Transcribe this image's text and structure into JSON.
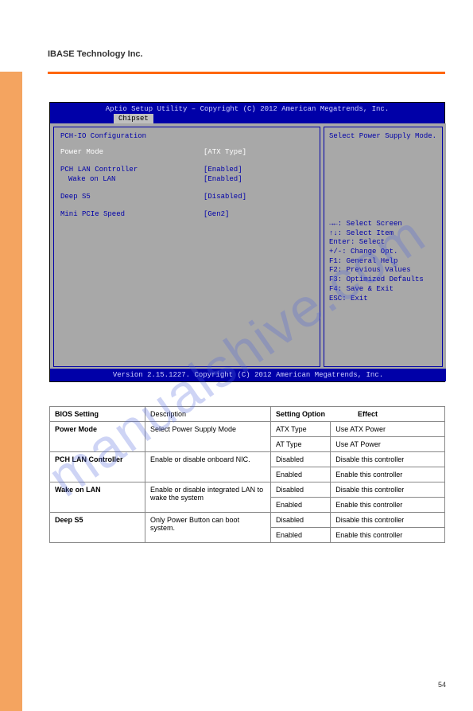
{
  "page": {
    "heading": "IBASE Technology Inc.",
    "page_number": "54"
  },
  "bios": {
    "title": "Aptio Setup Utility – Copyright (C) 2012 American Megatrends, Inc.",
    "tab": "Chipset",
    "section_label": "PCH-IO Configuration",
    "rows": {
      "power_mode": {
        "label": "Power Mode",
        "value": "[ATX Type]"
      },
      "pch_lan": {
        "label": "PCH LAN Controller",
        "value": "[Enabled]"
      },
      "wol": {
        "label": "Wake on LAN",
        "value": "[Enabled]"
      },
      "deep_s5": {
        "label": "Deep S5",
        "value": "[Disabled]"
      },
      "mini_pcie": {
        "label": "Mini PCIe Speed",
        "value": "[Gen2]"
      }
    },
    "help_text": "Select Power Supply Mode.",
    "keys": {
      "k1": "→←: Select Screen",
      "k2": "↑↓: Select Item",
      "k3": "Enter: Select",
      "k4": "+/-: Change Opt.",
      "k5": "F1: General Help",
      "k6": "F2: Previous Values",
      "k7": "F3: Optimized Defaults",
      "k8": "F4: Save & Exit",
      "k9": "ESC: Exit"
    },
    "footer": "Version 2.15.1227. Copyright (C) 2012 American Megatrends, Inc."
  },
  "table": {
    "r1c1": "BIOS Setting",
    "r1c2": "Description",
    "r1c3": "Setting Option",
    "r1c4": "Effect",
    "r2c1": "Power Mode",
    "r2c2": "Select Power Supply Mode",
    "r2c3a": "ATX Type",
    "r2c4a": "Use ATX Power",
    "r2c3b": "AT Type",
    "r2c4b": "Use AT Power",
    "r3c1": "PCH LAN Controller",
    "r3c2": "Enable or disable onboard NIC.",
    "r3c3a": "Disabled",
    "r3c4a": "Disable this controller",
    "r3c3b": "Enabled",
    "r3c4b": "Enable this controller",
    "r4c1": "Wake on LAN",
    "r4c2": "Enable or disable integrated LAN to wake the system",
    "r4c3a": "Disabled",
    "r4c4a": "Disable this controller",
    "r4c3b": "Enabled",
    "r4c4b": "Enable this controller",
    "r5c1": "Deep S5",
    "r5c2": "Only Power Button can boot system.",
    "r5c3a": "Disabled",
    "r5c4a": "Disable this controller",
    "r5c3b": "Enabled",
    "r5c4b": "Enable this controller"
  },
  "watermark": "manualshive.com"
}
